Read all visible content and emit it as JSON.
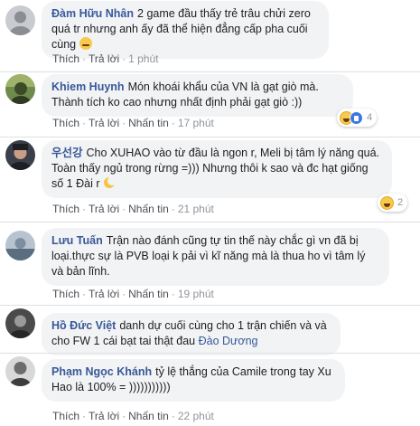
{
  "actions": {
    "like": "Thích",
    "reply": "Trả lời",
    "translate": "Nhấn tin"
  },
  "comments": [
    {
      "author": "Đàm Hữu Nhân",
      "text": "2 game đầu thấy trẻ trâu chửi zero quá tr nhưng anh ấy đã thể hiện đẳng cấp pha cuối cùng",
      "emoji": "relieved-face-icon",
      "time": "1 phút",
      "reactions": null
    },
    {
      "author": "Khiem Huynh",
      "text": "Món khoái khẩu của VN là gạt giò mà. Thành tích ko cao nhưng nhất định phải gạt giò :))",
      "time": "17 phút",
      "reactions": {
        "count": "4",
        "icons": [
          "haha-icon",
          "like-icon"
        ]
      }
    },
    {
      "author": "우선강",
      "text": "Cho XUHAO vào từ đầu là ngon r, Meli bị tâm lý năng quá. Toàn thấy ngủ trong rừng =))) Nhưng thôi k sao và đc hạt giống số 1 Đài r",
      "emoji": "crescent-moon-icon",
      "time": "21 phút",
      "reactions": {
        "count": "2",
        "icons": [
          "haha-icon"
        ]
      }
    },
    {
      "author": "Lưu Tuấn",
      "text": "Trận nào đánh cũng tự tin thế này chắc gì vn đã bị loại.thực sự là PVB loại k pải vì kĩ năng mà là thua ho vì tâm lý và bản lĩnh.",
      "time": "19 phút",
      "reactions": null
    },
    {
      "author": "Hồ Đức Việt",
      "text": "danh dự cuối cùng cho 1 trận chiến và và cho FW 1 cái bạt tai thật đau",
      "mention": "Đào Dương",
      "time": null,
      "reactions": null
    },
    {
      "author": "Phạm Ngọc Khánh",
      "text": "tỷ lệ thắng của Camile trong tay Xu Hao là 100% = )))))))))))",
      "time": "22 phút",
      "reactions": null
    }
  ],
  "colors": {
    "author": "#385898",
    "bubble": "#f2f3f5",
    "meta": "#90949c"
  }
}
